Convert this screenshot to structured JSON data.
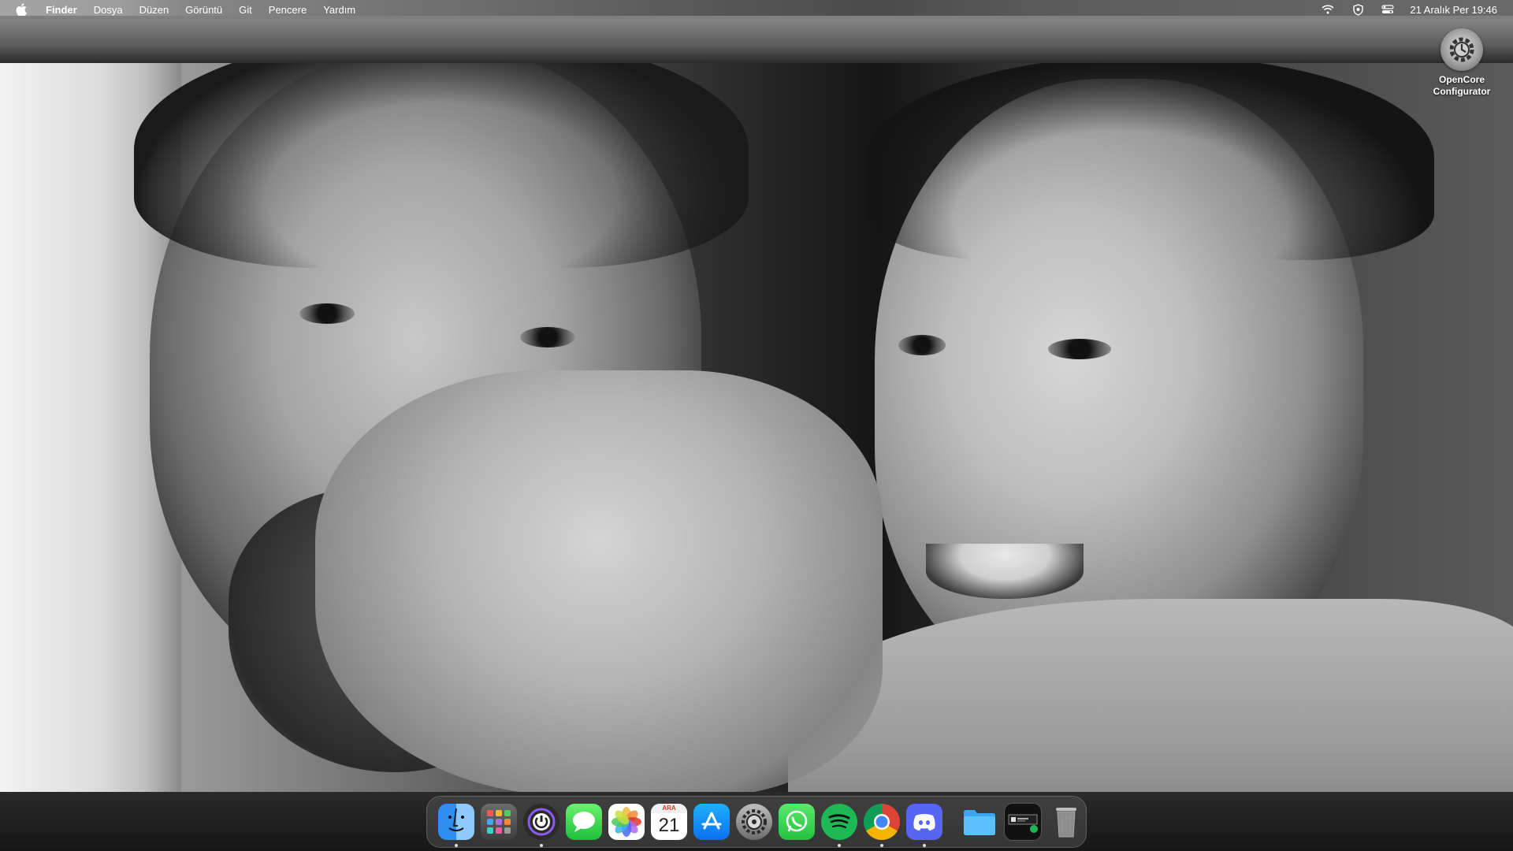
{
  "menubar": {
    "apple_icon": "apple-icon",
    "app_name": "Finder",
    "items": [
      "Dosya",
      "Düzen",
      "Görüntü",
      "Git",
      "Pencere",
      "Yardım"
    ],
    "status_icons": [
      "wifi-icon",
      "privacy-shield-icon",
      "control-center-icon"
    ],
    "clock": "21 Aralık Per  19:46"
  },
  "desktop": {
    "icons": [
      {
        "label_line1": "OpenCore",
        "label_line2": "Configurator",
        "icon": "opencore-gear-icon"
      }
    ]
  },
  "dock": {
    "apps": [
      {
        "name": "Finder",
        "icon": "finder-icon",
        "running": true
      },
      {
        "name": "Launchpad",
        "icon": "launchpad-icon",
        "running": false
      },
      {
        "name": "iStatistica",
        "icon": "istat-power-icon",
        "running": true
      },
      {
        "name": "Messages",
        "icon": "messages-icon",
        "running": false
      },
      {
        "name": "Photos",
        "icon": "photos-icon",
        "running": false
      },
      {
        "name": "Calendar",
        "icon": "calendar-icon",
        "running": false,
        "month": "ARA",
        "day": "21"
      },
      {
        "name": "App Store",
        "icon": "app-store-icon",
        "running": false
      },
      {
        "name": "System Settings",
        "icon": "system-settings-icon",
        "running": false
      },
      {
        "name": "WhatsApp",
        "icon": "whatsapp-icon",
        "running": false
      },
      {
        "name": "Spotify",
        "icon": "spotify-icon",
        "running": true
      },
      {
        "name": "Google Chrome",
        "icon": "chrome-icon",
        "running": true
      },
      {
        "name": "Discord",
        "icon": "discord-icon",
        "running": true
      }
    ],
    "stack": [
      {
        "name": "Folder",
        "icon": "folder-icon"
      },
      {
        "name": "Music Widget",
        "icon": "music-widget-icon"
      },
      {
        "name": "Trash",
        "icon": "trash-icon"
      }
    ]
  },
  "colors": {
    "menubar_text": "#ffffff",
    "running_dot": "#dddddd",
    "wallpaper_mode": "grayscale"
  }
}
